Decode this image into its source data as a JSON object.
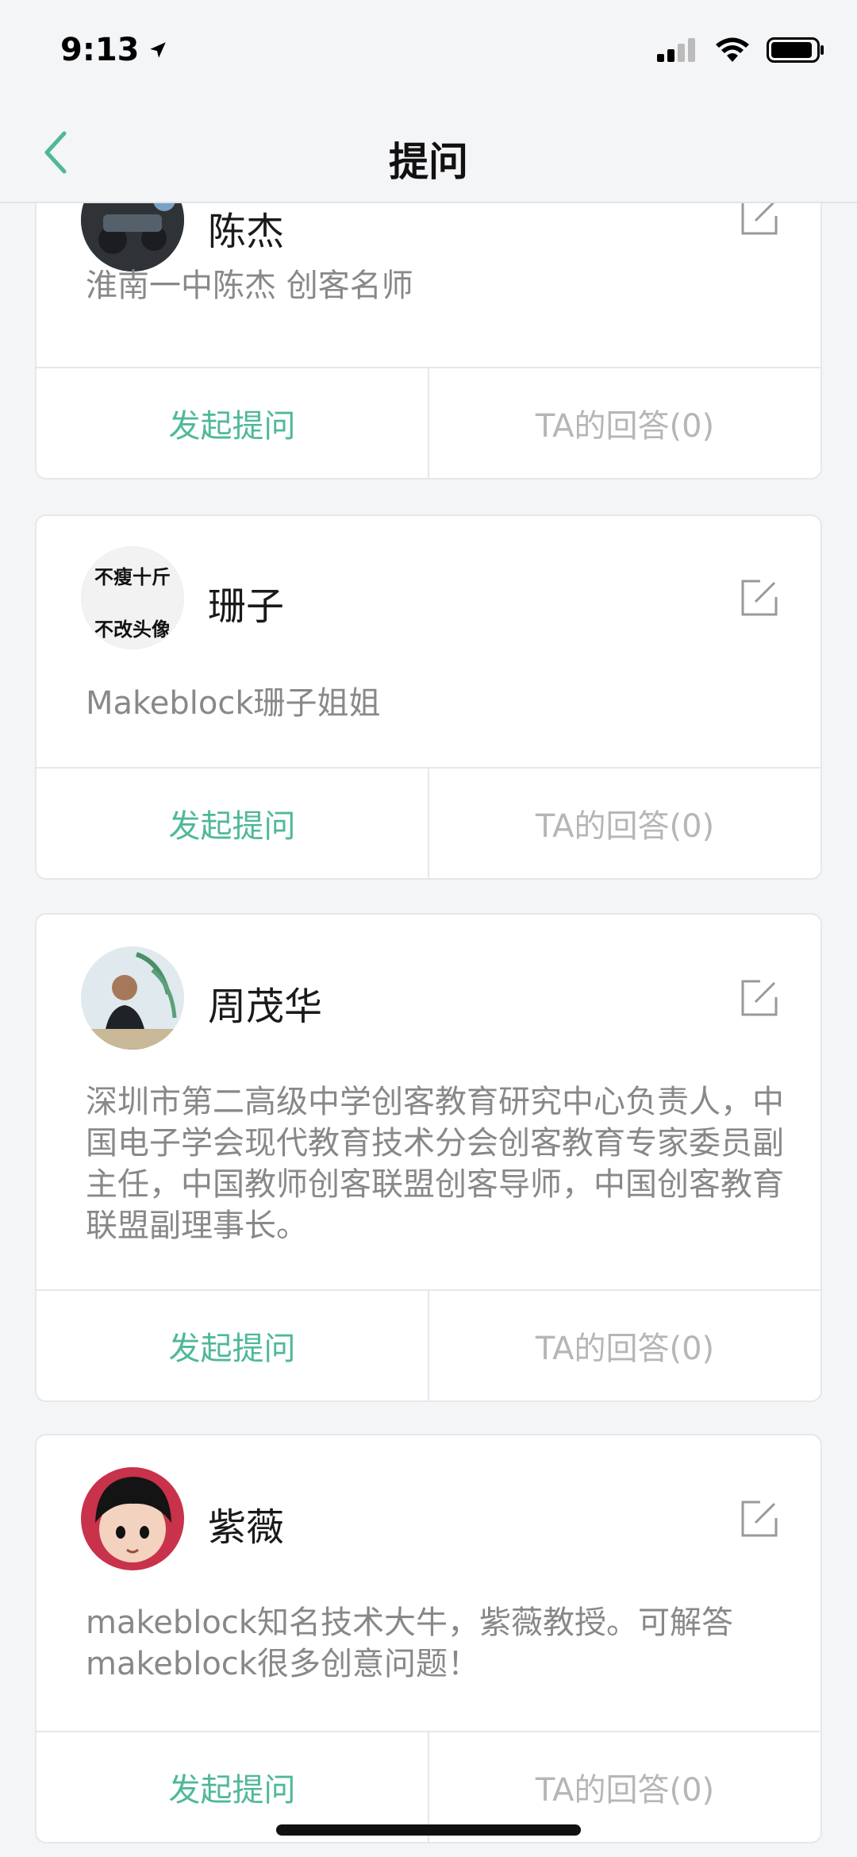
{
  "status": {
    "time": "9:13"
  },
  "nav": {
    "title": "提问"
  },
  "cards": [
    {
      "name": "陈杰",
      "description": "淮南一中陈杰 创客名师",
      "ask_label": "发起提问",
      "answers_label": "TA的回答(0)"
    },
    {
      "name": "珊子",
      "avatar_text_line1": "不瘦十斤",
      "avatar_text_line2": "不改头像",
      "description": "Makeblock珊子姐姐",
      "ask_label": "发起提问",
      "answers_label": "TA的回答(0)"
    },
    {
      "name": "周茂华",
      "description": "深圳市第二高级中学创客教育研究中心负责人，中国电子学会现代教育技术分会创客教育专家委员副主任，中国教师创客联盟创客导师，中国创客教育联盟副理事长。",
      "ask_label": "发起提问",
      "answers_label": "TA的回答(0)"
    },
    {
      "name": "紫薇",
      "description": "makeblock知名技术大牛，紫薇教授。可解答makeblock很多创意问题！",
      "ask_label": "发起提问",
      "answers_label": "TA的回答(0)"
    }
  ],
  "colors": {
    "accent": "#4fb89a",
    "muted": "#b6b6b6",
    "background": "#f4f5f7"
  }
}
